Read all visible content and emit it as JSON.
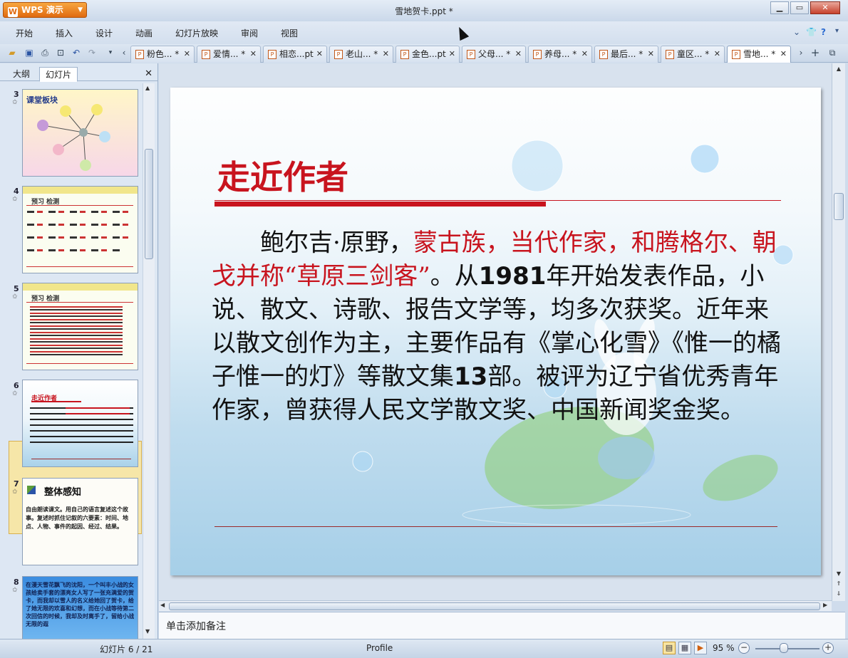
{
  "window": {
    "app_label": "WPS 演示",
    "title": "雪地贺卡.ppt *"
  },
  "menu": [
    "开始",
    "插入",
    "设计",
    "动画",
    "幻灯片放映",
    "审阅",
    "视图"
  ],
  "doc_tabs": [
    {
      "label": "粉色... *"
    },
    {
      "label": "爱情... *"
    },
    {
      "label": "相恋...pt"
    },
    {
      "label": "老山... *"
    },
    {
      "label": "金色...pt"
    },
    {
      "label": "父母... *"
    },
    {
      "label": "养母... *"
    },
    {
      "label": "最后... *"
    },
    {
      "label": "童区... *"
    },
    {
      "label": "雪地... *"
    }
  ],
  "sidebar": {
    "tabs": [
      "大纲",
      "幻灯片"
    ],
    "slides": [
      {
        "num": "3",
        "heading": "课堂板块"
      },
      {
        "num": "4",
        "heading": "预习 检测"
      },
      {
        "num": "5",
        "heading": "预习 检测"
      },
      {
        "num": "6",
        "heading": "走近作者"
      },
      {
        "num": "7",
        "heading": "整体感知",
        "text": "自由朗读课文。用自己的语言复述这个故事。复述时抓住记叙的六要素：时间、地点、人物、事件的起因、经过、结果。"
      },
      {
        "num": "8",
        "text": "在漫天雪花飘飞的沈阳，一个叫丰小战的女孩给卖手套的漂亮女人写了一张充满爱的贺卡，而我却以雪人的名义给她回了贺卡，给了她无限的欢喜和幻想，而在小战等待第二次回信的时候，我却及时离手了，留给小战无限的遐"
      }
    ],
    "selected_index": 3
  },
  "slide": {
    "title": "走近作者",
    "body": [
      {
        "text": "鲍尔吉·原野，",
        "style": "normal"
      },
      {
        "text": "蒙古族，当代作家，和腾格尔、朝戈并称“草原三剑客”",
        "style": "red"
      },
      {
        "text": "。从",
        "style": "normal"
      },
      {
        "text": "1981",
        "style": "num"
      },
      {
        "text": "年开始发表作品，小说、散文、诗歌、报告文学等，均多次获奖。近年来以散文创作为主，主要作品有《掌心化雪》《惟一的橘子惟一的灯》等散文集",
        "style": "normal"
      },
      {
        "text": "13",
        "style": "num"
      },
      {
        "text": "部。被评为辽宁省优秀青年作家，曾获得人民文学散文奖、中国新闻奖金奖。",
        "style": "normal"
      }
    ]
  },
  "notes": {
    "placeholder": "单击添加备注"
  },
  "status": {
    "slide_counter": "幻灯片 6 / 21",
    "profile": "Profile",
    "zoom": "95 %"
  },
  "colors": {
    "accent_red": "#c8141e",
    "wps_orange": "#e06a10"
  }
}
